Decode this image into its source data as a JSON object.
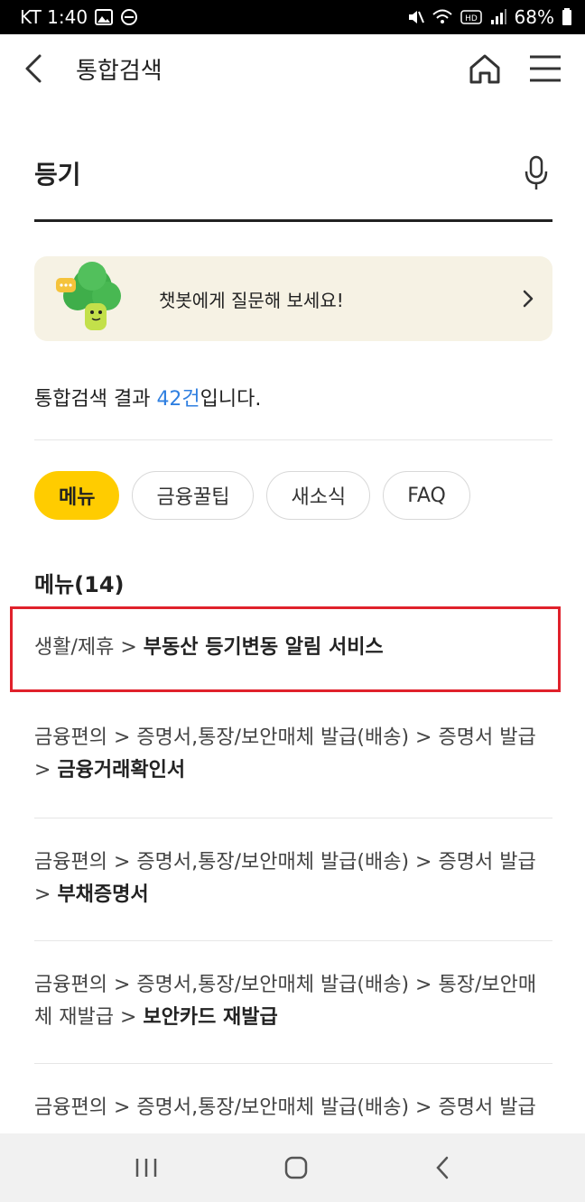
{
  "status_bar": {
    "carrier_time": "KT 1:40",
    "battery": "68%"
  },
  "header": {
    "title": "통합검색"
  },
  "search": {
    "query": "등기"
  },
  "chatbot": {
    "text": "챗봇에게 질문해 보세요!"
  },
  "results": {
    "prefix": "통합검색 결과 ",
    "count": "42건",
    "suffix": "입니다."
  },
  "chips": [
    {
      "label": "메뉴",
      "active": true
    },
    {
      "label": "금융꿀팁",
      "active": false
    },
    {
      "label": "새소식",
      "active": false
    },
    {
      "label": "FAQ",
      "active": false
    }
  ],
  "section": {
    "title": "메뉴(14)"
  },
  "items": [
    {
      "path": "생활/제휴 > ",
      "bold_pre": "부동산 ",
      "bold_accent": "등기",
      "bold_post": "변동 알림 서비스"
    },
    {
      "path": "금융편의 > 증명서,통장/보안매체 발급(배송) > 증명서 발급 > ",
      "bold": "금융거래확인서"
    },
    {
      "path": "금융편의 > 증명서,통장/보안매체 발급(배송) > 증명서 발급 > ",
      "bold": "부채증명서"
    },
    {
      "path": "금융편의 > 증명서,통장/보안매체 발급(배송) > 통장/보안매체 재발급 > ",
      "bold": "보안카드 재발급"
    },
    {
      "path": "금융편의 > 증명서,통장/보안매체 발급(배송) > 증명서 발급 > "
    }
  ],
  "icons": {
    "back": "chevron-left-icon",
    "home": "home-icon",
    "menu": "hamburger-menu-icon",
    "mic": "microphone-icon",
    "chatbot_arrow": "chevron-right-icon"
  },
  "colors": {
    "accent_yellow": "#ffcc00",
    "accent_blue": "#2f7fe0",
    "highlight_red": "#e0212b",
    "chatbot_bg": "#f6f2e4"
  }
}
